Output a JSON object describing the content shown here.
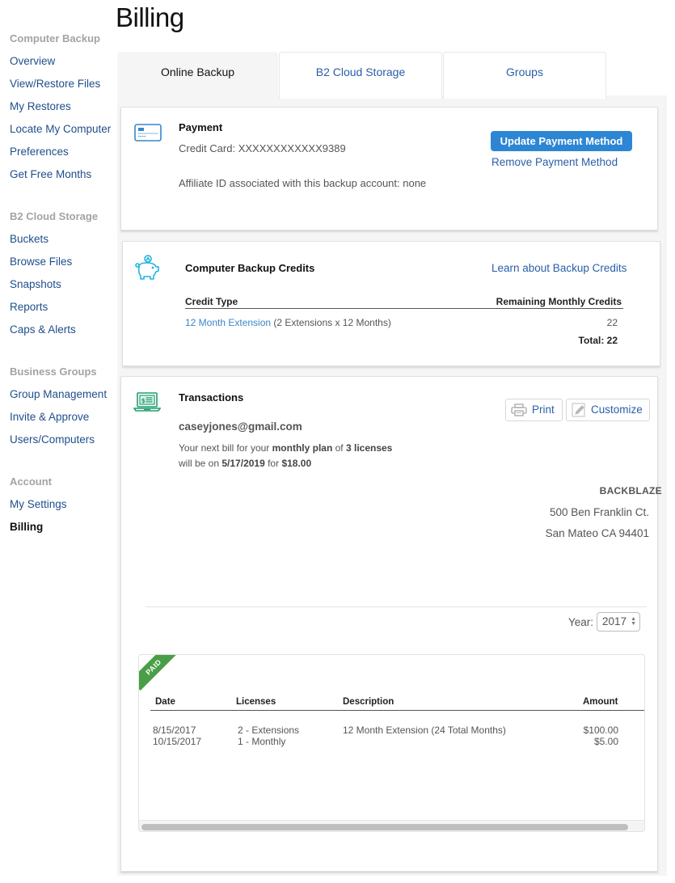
{
  "sidebar": {
    "groups": [
      {
        "heading": "Computer Backup",
        "items": [
          "Overview",
          "View/Restore Files",
          "My Restores",
          "Locate My Computer",
          "Preferences",
          "Get Free Months"
        ]
      },
      {
        "heading": "B2 Cloud Storage",
        "items": [
          "Buckets",
          "Browse Files",
          "Snapshots",
          "Reports",
          "Caps & Alerts"
        ]
      },
      {
        "heading": "Business Groups",
        "items": [
          "Group Management",
          "Invite & Approve",
          "Users/Computers"
        ]
      },
      {
        "heading": "Account",
        "items": [
          "My Settings",
          "Billing"
        ]
      }
    ],
    "active_item": "Billing"
  },
  "page": {
    "title": "Billing"
  },
  "tabs": [
    {
      "label": "Online Backup",
      "active": true
    },
    {
      "label": "B2 Cloud Storage",
      "active": false
    },
    {
      "label": "Groups",
      "active": false
    }
  ],
  "payment": {
    "icon": "credit-card-icon",
    "title": "Payment",
    "credit_card_label": "Credit Card:",
    "credit_card_value": "XXXXXXXXXXXX9389",
    "affiliate_text": "Affiliate ID associated with this backup account: none",
    "update_button": "Update Payment Method",
    "remove_link": "Remove Payment Method"
  },
  "credits": {
    "icon": "piggy-bank-icon",
    "title": "Computer Backup Credits",
    "learn_link": "Learn about Backup Credits",
    "col_type": "Credit Type",
    "col_remaining": "Remaining Monthly Credits",
    "rows": [
      {
        "type_link": "12 Month Extension",
        "type_detail": "(2 Extensions x 12 Months)",
        "remaining": "22"
      }
    ],
    "total_label": "Total: 22"
  },
  "transactions": {
    "icon": "laptop-invoice-icon",
    "title": "Transactions",
    "print_button": "Print",
    "customize_button": "Customize",
    "email": "caseyjones@gmail.com",
    "next_bill": {
      "p1": "Your next bill for your ",
      "plan": "monthly plan",
      "p2": " of ",
      "licenses": "3 licenses",
      "p3": "will be on ",
      "date": "5/17/2019",
      "p4": " for ",
      "amount": "$18.00"
    },
    "company": {
      "name": "BACKBLAZE",
      "address1": "500 Ben Franklin Ct.",
      "address2": "San Mateo CA 94401"
    },
    "year_label": "Year:",
    "year_value": "2017",
    "invoice": {
      "status": "PAID",
      "status_color": "#4a9e47",
      "columns": [
        "Date",
        "Licenses",
        "Description",
        "Amount"
      ],
      "rows": [
        {
          "date": "8/15/2017",
          "licenses": "2 - Extensions",
          "description": "12 Month Extension (24 Total Months)",
          "amount": "$100.00"
        },
        {
          "date": "10/15/2017",
          "licenses": "1 - Monthly",
          "description": "",
          "amount": "$5.00"
        }
      ]
    }
  },
  "colors": {
    "link": "#2a5ea8",
    "primary_button": "#2d86d4",
    "paid_green": "#4a9e47",
    "icon_blue": "#3a86c8",
    "icon_cyan": "#1fb4e0",
    "icon_green": "#1f9e6e"
  }
}
